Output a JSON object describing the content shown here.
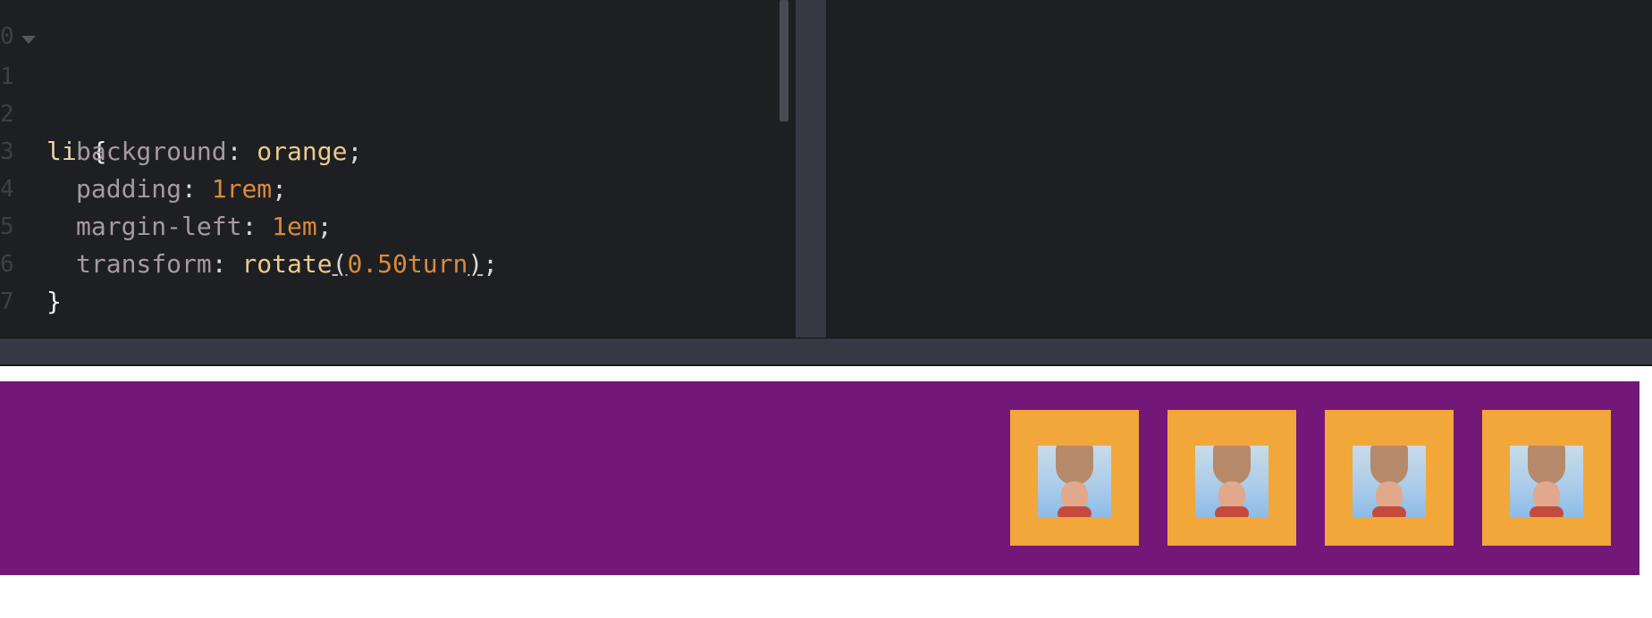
{
  "editor": {
    "lines": [
      {
        "num": "0"
      },
      {
        "num": "1",
        "sel": "li",
        "open": "{"
      },
      {
        "num": "2",
        "prop": "background",
        "colon": ":",
        "value": "orange",
        "semi": ";"
      },
      {
        "num": "3",
        "prop": "padding",
        "colon": ":",
        "value": "1rem",
        "semi": ";"
      },
      {
        "num": "4",
        "prop": "margin-left",
        "colon": ":",
        "value": "1em",
        "semi": ";"
      },
      {
        "num": "5",
        "prop": "transform",
        "colon": ":",
        "fn": "rotate",
        "paren_open": "(",
        "arg": "0.50turn",
        "paren_close": ")",
        "semi": ";"
      },
      {
        "num": "6",
        "close": "}"
      },
      {
        "num": "7"
      }
    ]
  },
  "preview": {
    "list_items": [
      {
        "image": "upside-down-photo"
      },
      {
        "image": "upside-down-photo"
      },
      {
        "image": "upside-down-photo"
      },
      {
        "image": "upside-down-photo"
      }
    ]
  },
  "colors": {
    "editor_bg": "#1e1f23",
    "purple": "#731878",
    "orange": "#f2a73b"
  }
}
